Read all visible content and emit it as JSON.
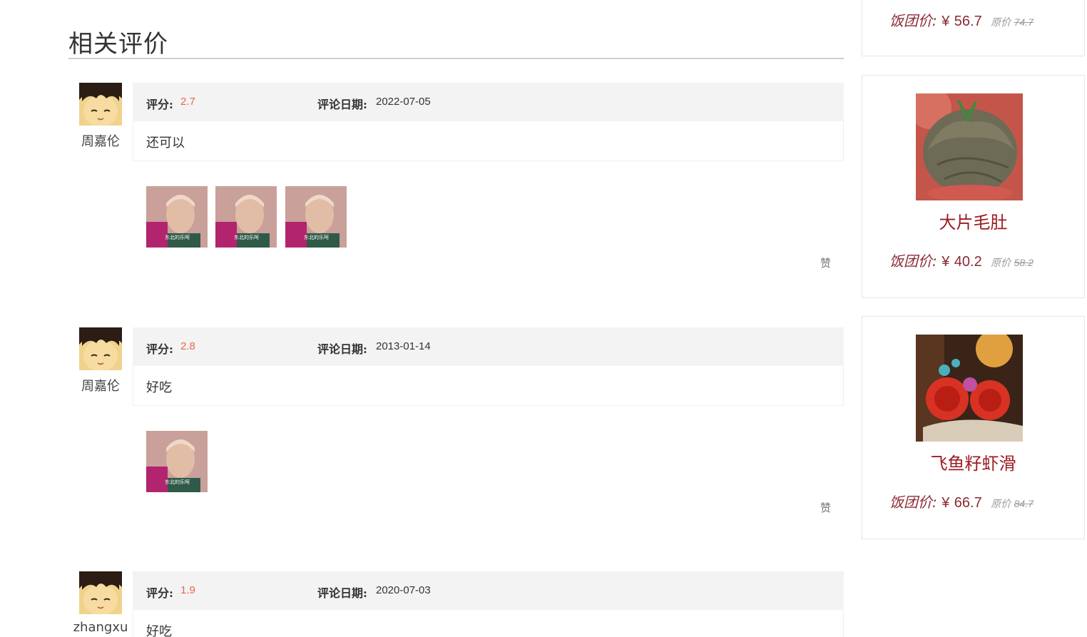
{
  "section": {
    "title": "相关评价"
  },
  "labels": {
    "score": "评分:",
    "date": "评论日期:",
    "like": "赞",
    "group_price": "饭团价:",
    "currency": "¥",
    "orig_price": "原价"
  },
  "reviews": [
    {
      "user": "周嘉伦",
      "score": "2.7",
      "date": "2022-07-05",
      "text": "还可以",
      "photo_count": 3
    },
    {
      "user": "周嘉伦",
      "score": "2.8",
      "date": "2013-01-14",
      "text": "好吃",
      "photo_count": 1
    },
    {
      "user": "zhangxu",
      "score": "1.9",
      "date": "2020-07-03",
      "text": "好吃",
      "photo_count": 0
    }
  ],
  "sidebar": {
    "products": [
      {
        "name": "",
        "price": "56.7",
        "orig": "74.7"
      },
      {
        "name": "大片毛肚",
        "price": "40.2",
        "orig": "58.2"
      },
      {
        "name": "飞鱼籽虾滑",
        "price": "66.7",
        "orig": "84.7"
      }
    ]
  },
  "colors": {
    "score": "#e8664a",
    "product_name": "#9b1c24",
    "price": "#8b2a34"
  }
}
